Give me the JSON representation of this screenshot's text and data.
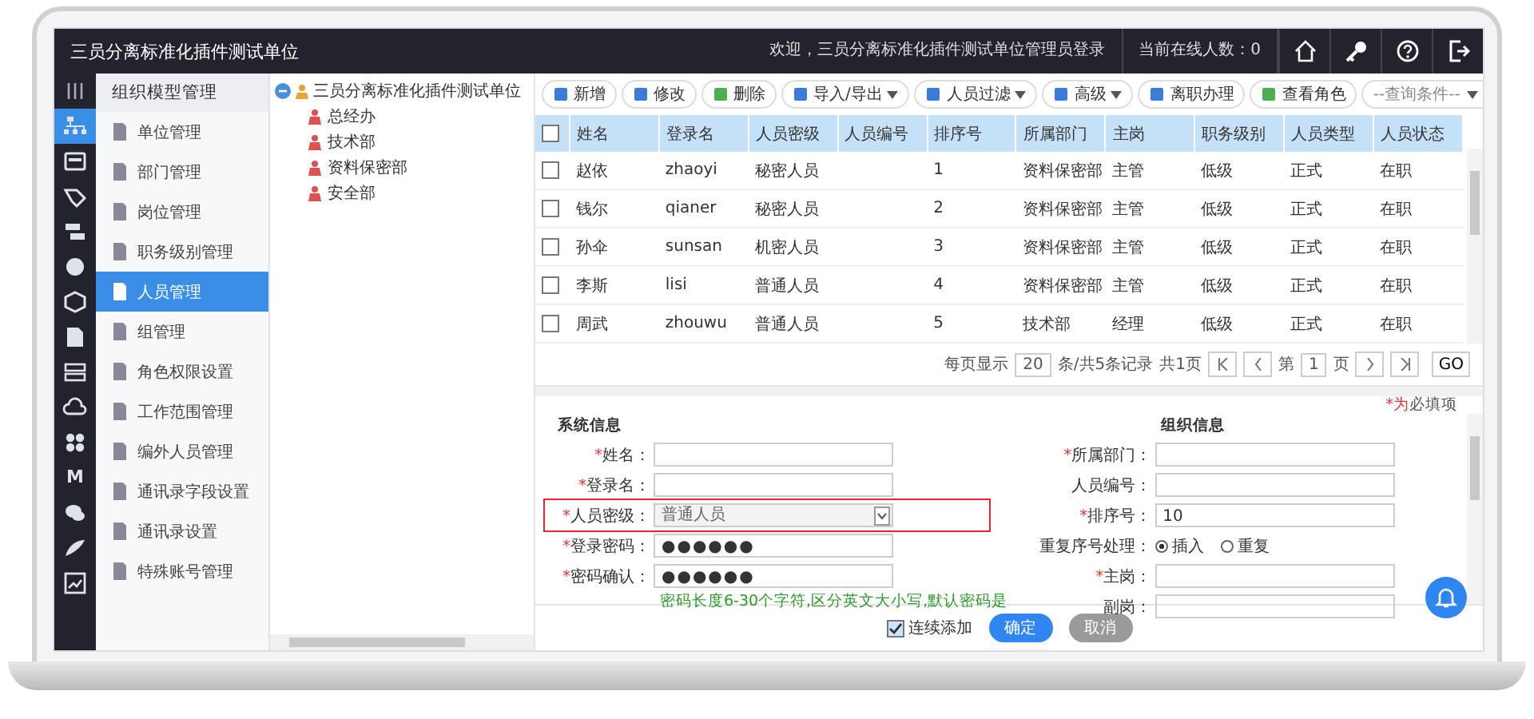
{
  "app": {
    "title": "三员分离标准化插件测试单位",
    "welcome": "欢迎，三员分离标准化插件测试单位管理员登录",
    "online": "当前在线人数：0"
  },
  "rail_items": [
    {
      "selected": true
    },
    {
      "selected": false
    },
    {
      "selected": false
    },
    {
      "selected": false
    },
    {
      "selected": false
    },
    {
      "selected": false
    },
    {
      "selected": false
    },
    {
      "selected": false
    },
    {
      "selected": false
    },
    {
      "selected": false
    },
    {
      "selected": false,
      "glyph": "M"
    },
    {
      "selected": false
    },
    {
      "selected": false
    },
    {
      "selected": false
    }
  ],
  "sidebar": {
    "title": "组织模型管理",
    "items": [
      {
        "label": "单位管理",
        "selected": false
      },
      {
        "label": "部门管理",
        "selected": false
      },
      {
        "label": "岗位管理",
        "selected": false
      },
      {
        "label": "职务级别管理",
        "selected": false
      },
      {
        "label": "人员管理",
        "selected": true
      },
      {
        "label": "组管理",
        "selected": false
      },
      {
        "label": "角色权限设置",
        "selected": false
      },
      {
        "label": "工作范围管理",
        "selected": false
      },
      {
        "label": "编外人员管理",
        "selected": false
      },
      {
        "label": "通讯录字段设置",
        "selected": false
      },
      {
        "label": "通讯录设置",
        "selected": false
      },
      {
        "label": "特殊账号管理",
        "selected": false
      }
    ]
  },
  "tree": {
    "label": "三员分离标准化插件测试单位",
    "expanded": true,
    "children": [
      {
        "label": "总经办"
      },
      {
        "label": "技术部"
      },
      {
        "label": "资料保密部"
      },
      {
        "label": "安全部"
      }
    ]
  },
  "toolbar": [
    {
      "label": "新增",
      "kind": "add",
      "dropdown": false
    },
    {
      "label": "修改",
      "kind": "edit",
      "dropdown": false
    },
    {
      "label": "删除",
      "kind": "delete",
      "dropdown": false
    },
    {
      "label": "导入/导出",
      "kind": "import",
      "dropdown": true
    },
    {
      "label": "人员过滤",
      "kind": "filter",
      "dropdown": true
    },
    {
      "label": "高级",
      "kind": "advanced",
      "dropdown": true
    },
    {
      "label": "离职办理",
      "kind": "resign",
      "dropdown": false
    },
    {
      "label": "查看角色",
      "kind": "role",
      "dropdown": false
    }
  ],
  "search": {
    "placeholder": "--查询条件--"
  },
  "table": {
    "all_selected": false,
    "columns": [
      "姓名",
      "登录名",
      "人员密级",
      "人员编号",
      "排序号",
      "所属部门",
      "主岗",
      "职务级别",
      "人员类型",
      "人员状态"
    ],
    "rows": [
      {
        "selected": false,
        "cells": [
          "赵依",
          "zhaoyi",
          "秘密人员",
          "",
          "1",
          "资料保密部",
          "主管",
          "低级",
          "正式",
          "在职"
        ]
      },
      {
        "selected": false,
        "cells": [
          "钱尔",
          "qianer",
          "秘密人员",
          "",
          "2",
          "资料保密部",
          "主管",
          "低级",
          "正式",
          "在职"
        ]
      },
      {
        "selected": false,
        "cells": [
          "孙伞",
          "sunsan",
          "机密人员",
          "",
          "3",
          "资料保密部",
          "主管",
          "低级",
          "正式",
          "在职"
        ]
      },
      {
        "selected": false,
        "cells": [
          "李斯",
          "lisi",
          "普通人员",
          "",
          "4",
          "资料保密部",
          "主管",
          "低级",
          "正式",
          "在职"
        ]
      },
      {
        "selected": false,
        "cells": [
          "周武",
          "zhouwu",
          "普通人员",
          "",
          "5",
          "技术部",
          "经理",
          "低级",
          "正式",
          "在职"
        ]
      }
    ]
  },
  "pagination": {
    "per_page_label": "每页显示",
    "per_page": "20",
    "summary": "条/共5条记录",
    "pages": "共1页",
    "page_prefix": "第",
    "page": "1",
    "page_suffix": "页",
    "go": "GO"
  },
  "form": {
    "required_note": "*为必填项",
    "left": {
      "title": "系统信息",
      "fields": [
        {
          "mark": "*",
          "label": "姓名：",
          "kind": "text",
          "highlighted": false
        },
        {
          "mark": "*",
          "label": "登录名：",
          "kind": "text",
          "highlighted": false
        },
        {
          "mark": "*",
          "label": "人员密级：",
          "kind": "select",
          "value": "普通人员",
          "highlighted": true
        },
        {
          "mark": "*",
          "label": "登录密码：",
          "kind": "text",
          "value": "●●●●●●",
          "highlighted": false
        },
        {
          "mark": "*",
          "label": "密码确认：",
          "kind": "text",
          "value": "●●●●●●",
          "highlighted": false
        }
      ],
      "hint": "密码长度6-30个字符,区分英文大小写,默认密码是"
    },
    "right": {
      "title": "组织信息",
      "fields": [
        {
          "mark": "*",
          "label": "所属部门：",
          "kind": "text"
        },
        {
          "label": "人员编号：",
          "kind": "text"
        },
        {
          "mark": "*",
          "label": "排序号：",
          "kind": "text",
          "value": "10"
        },
        {
          "label": "重复序号处理：",
          "kind": "radio",
          "options": [
            {
              "label": "插入",
              "selected": true
            },
            {
              "label": "重复",
              "selected": false
            }
          ]
        },
        {
          "mark": "*",
          "label": "主岗：",
          "kind": "text"
        },
        {
          "label": "副岗：",
          "kind": "text"
        }
      ]
    }
  },
  "footer": {
    "continuous": {
      "label": "连续添加",
      "checked": true
    },
    "confirm": "确定",
    "cancel": "取消"
  }
}
